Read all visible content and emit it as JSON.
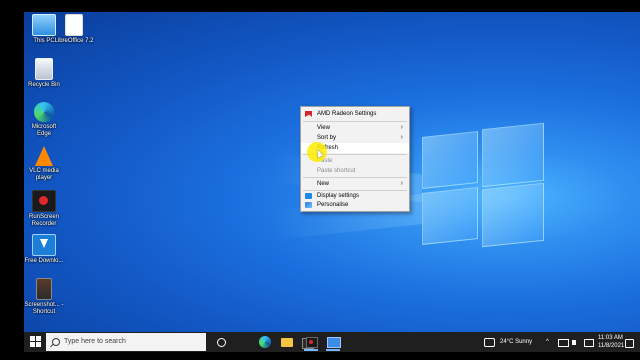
{
  "desktop": {
    "icons": [
      {
        "label": "This PC",
        "icon": "this-pc-icon"
      },
      {
        "label": "LibreOffice 7.2",
        "icon": "libreoffice-icon"
      },
      {
        "label": "Recycle Bin",
        "icon": "recycle-bin-icon"
      },
      {
        "label": "Microsoft Edge",
        "icon": "edge-icon"
      },
      {
        "label": "VLC media player",
        "icon": "vlc-icon"
      },
      {
        "label": "RunScreen Recorder",
        "icon": "screen-recorder-icon"
      },
      {
        "label": "Free Downlo...",
        "icon": "free-download-icon"
      },
      {
        "label": "Screenshot... - Shortcut",
        "icon": "shortcut-icon"
      }
    ]
  },
  "context_menu": {
    "items": [
      {
        "label": "AMD Radeon Settings",
        "icon": "amd-radeon-icon"
      },
      {
        "label": "View",
        "submenu": true
      },
      {
        "label": "Sort by",
        "submenu": true
      },
      {
        "label": "Refresh",
        "hovered": true
      },
      {
        "label": "Paste",
        "disabled": true
      },
      {
        "label": "Paste shortcut",
        "disabled": true
      },
      {
        "label": "New",
        "submenu": true
      },
      {
        "label": "Display settings",
        "icon": "display-settings-icon"
      },
      {
        "label": "Personalise",
        "icon": "personalise-icon"
      }
    ],
    "submenu_arrow": "›"
  },
  "taskbar": {
    "search_placeholder": "Type here to search",
    "weather": "24°C  Sunny",
    "time": "11:03 AM",
    "date": "11/8/2021",
    "pinned": [
      "task-view-icon",
      "edge-icon",
      "file-explorer-icon",
      "store-icon",
      "screen-recorder-icon",
      "remote-desktop-icon"
    ]
  },
  "colors": {
    "accent": "#78b4ff",
    "taskbar_bg": "#1f1f1f",
    "desktop_bg": "#1b6fde",
    "cursor_highlight": "#ffec00"
  }
}
